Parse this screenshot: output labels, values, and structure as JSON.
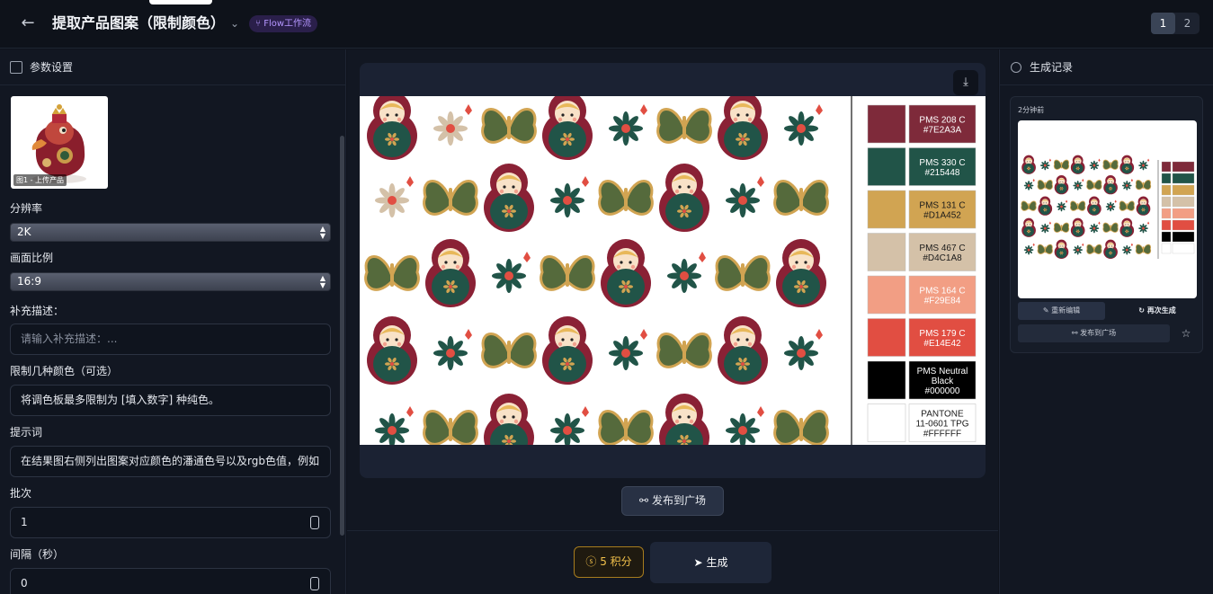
{
  "header": {
    "title": "提取产品图案（限制颜色）",
    "badge": "Flow工作流",
    "pages": [
      "1",
      "2"
    ]
  },
  "left": {
    "heading": "参数设置",
    "upload_caption": "图1 - 上传产品",
    "resolution_label": "分辨率",
    "resolution_value": "2K",
    "ratio_label": "画面比例",
    "ratio_value": "16:9",
    "extra_label": "补充描述：",
    "extra_placeholder": "请输入补充描述：...",
    "color_limit_label": "限制几种颜色（可选）",
    "color_limit_value": "将调色板最多限制为 [填入数字] 种纯色。",
    "prompt_label": "提示词",
    "prompt_value": "在结果图右侧列出图案对应颜色的潘通色号以及rgb色值，例如",
    "batch_label": "批次",
    "batch_value": "1",
    "interval_label": "间隔（秒）",
    "interval_value": "0"
  },
  "center": {
    "publish_label": "发布到广场",
    "cost_label": "5 积分",
    "generate_label": "生成",
    "swatches": [
      {
        "line1": "PMS 208 C",
        "line2": "#7E2A3A",
        "line3": "",
        "color": "#7e2a3a",
        "text": "#ffffff"
      },
      {
        "line1": "PMS 330 C",
        "line2": "#215448",
        "line3": "",
        "color": "#215448",
        "text": "#ffffff"
      },
      {
        "line1": "PMS 131 C",
        "line2": "#D1A452",
        "line3": "",
        "color": "#d1a452",
        "text": "#1a1a1a"
      },
      {
        "line1": "PMS 467 C",
        "line2": "#D4C1A8",
        "line3": "",
        "color": "#d4c1a8",
        "text": "#1a1a1a"
      },
      {
        "line1": "PMS 164 C",
        "line2": "#F29E84",
        "line3": "",
        "color": "#f29e84",
        "text": "#ffffff"
      },
      {
        "line1": "PMS 179 C",
        "line2": "#E14E42",
        "line3": "",
        "color": "#e14e42",
        "text": "#ffffff"
      },
      {
        "line1": "PMS Neutral",
        "line2": "Black",
        "line3": "#000000",
        "color": "#000000",
        "text": "#ffffff"
      },
      {
        "line1": "PANTONE",
        "line2": "11-0601 TPG",
        "line3": "#FFFFFF",
        "color": "#ffffff",
        "text": "#1a1a1a"
      }
    ]
  },
  "right": {
    "heading": "生成记录",
    "time": "2分钟前",
    "edit_label": "重新编辑",
    "regen_label": "再次生成",
    "share_label": "发布到广场"
  },
  "colors": {
    "accent_purple": "#b596ff",
    "cost_gold": "#f2c14b"
  }
}
